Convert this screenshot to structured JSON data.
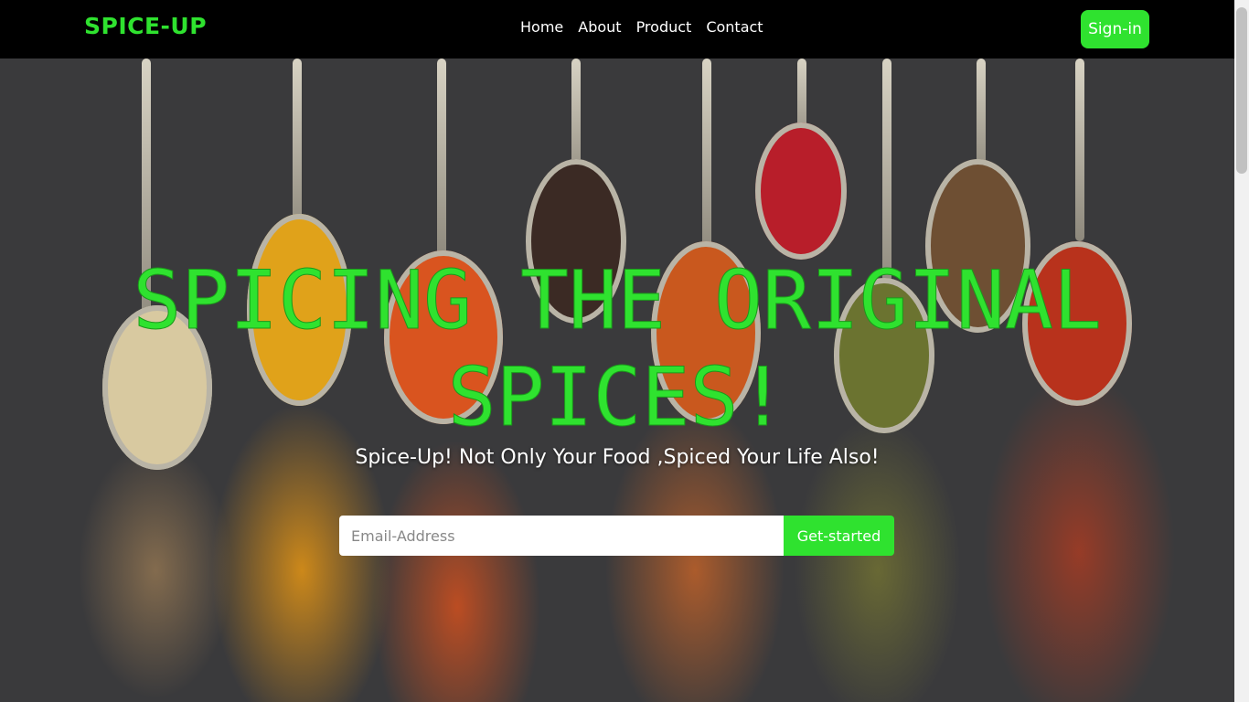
{
  "nav": {
    "brand": "SPICE-UP",
    "links": [
      "Home",
      "About",
      "Product",
      "Contact"
    ],
    "signin_label": "Sign-in"
  },
  "hero": {
    "title": "SPICING THE ORIGINAL SPICES!",
    "subtitle": "Spice-Up! Not Only Your Food ,Spiced Your Life Also!",
    "email_placeholder": "Email-Address",
    "cta_label": "Get-started"
  },
  "colors": {
    "accent": "#2fe22f",
    "navbar_bg": "#000000"
  }
}
